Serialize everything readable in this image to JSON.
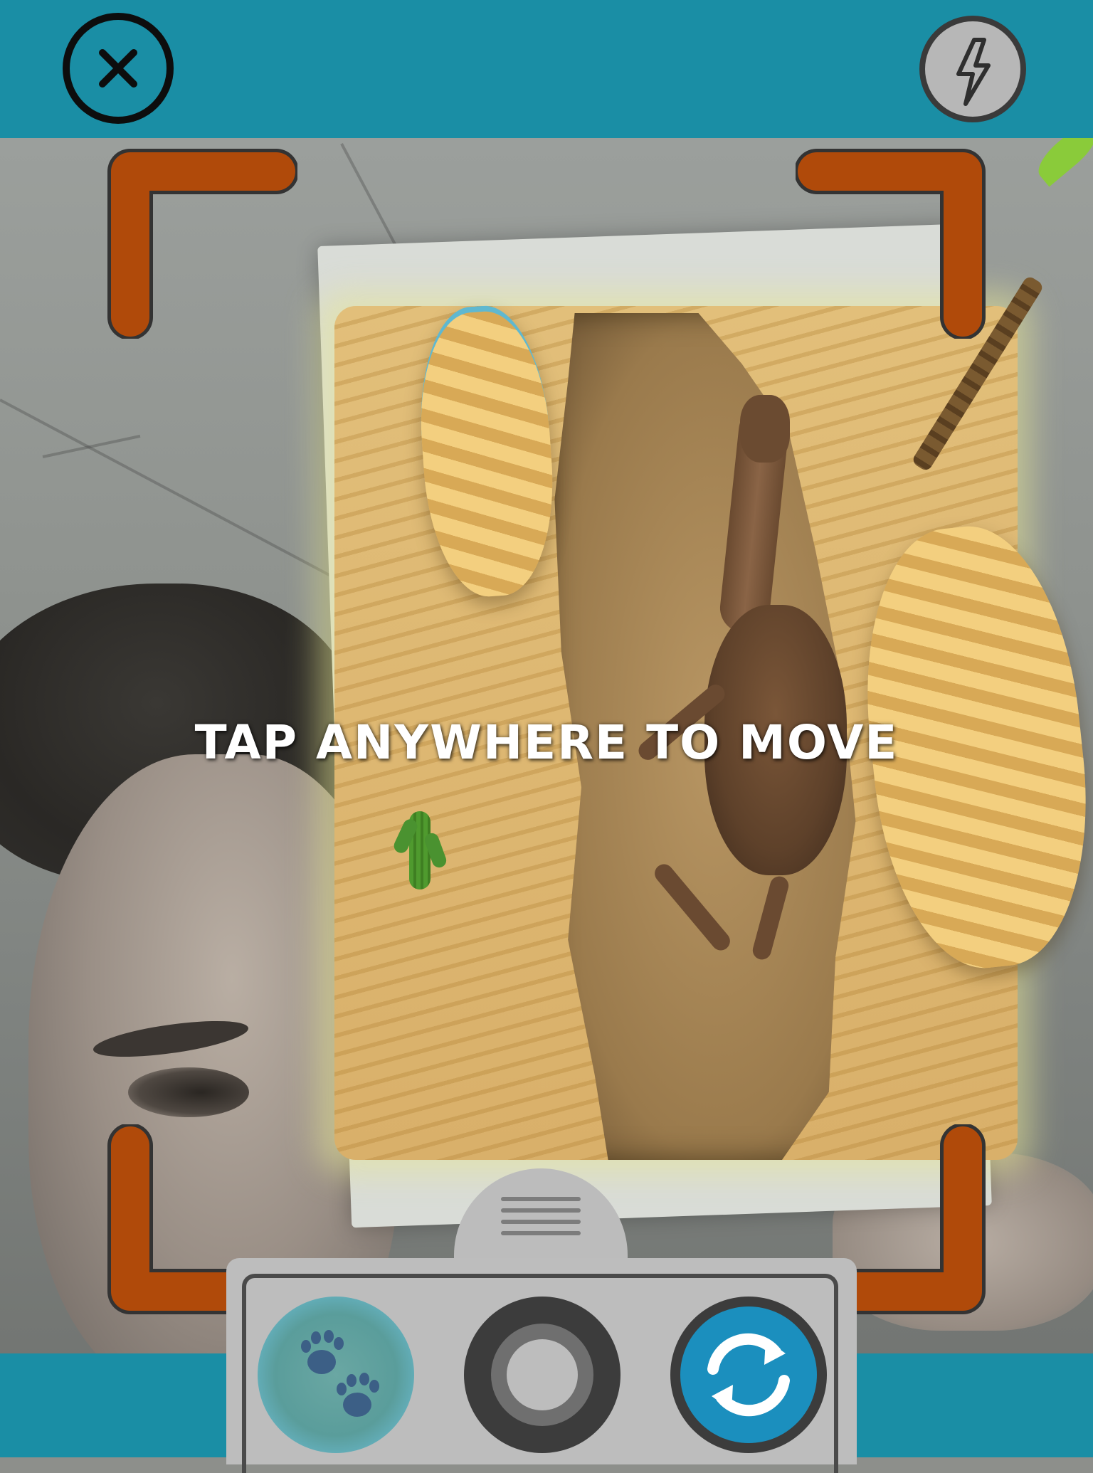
{
  "top_bar": {
    "close_icon": "close-x-icon",
    "flash_icon": "flash-bolt-icon"
  },
  "instruction": {
    "text": "TAP ANYWHERE TO MOVE"
  },
  "toolbar": {
    "animal_icon": "paw-prints-icon",
    "capture_icon": "shutter-icon",
    "switch_icon": "camera-switch-icon"
  },
  "colors": {
    "bar": "#1a8ea5",
    "frame_corner": "#b04a0a",
    "switch_button": "#1b8fbe",
    "panel": "#bdbdbd"
  }
}
